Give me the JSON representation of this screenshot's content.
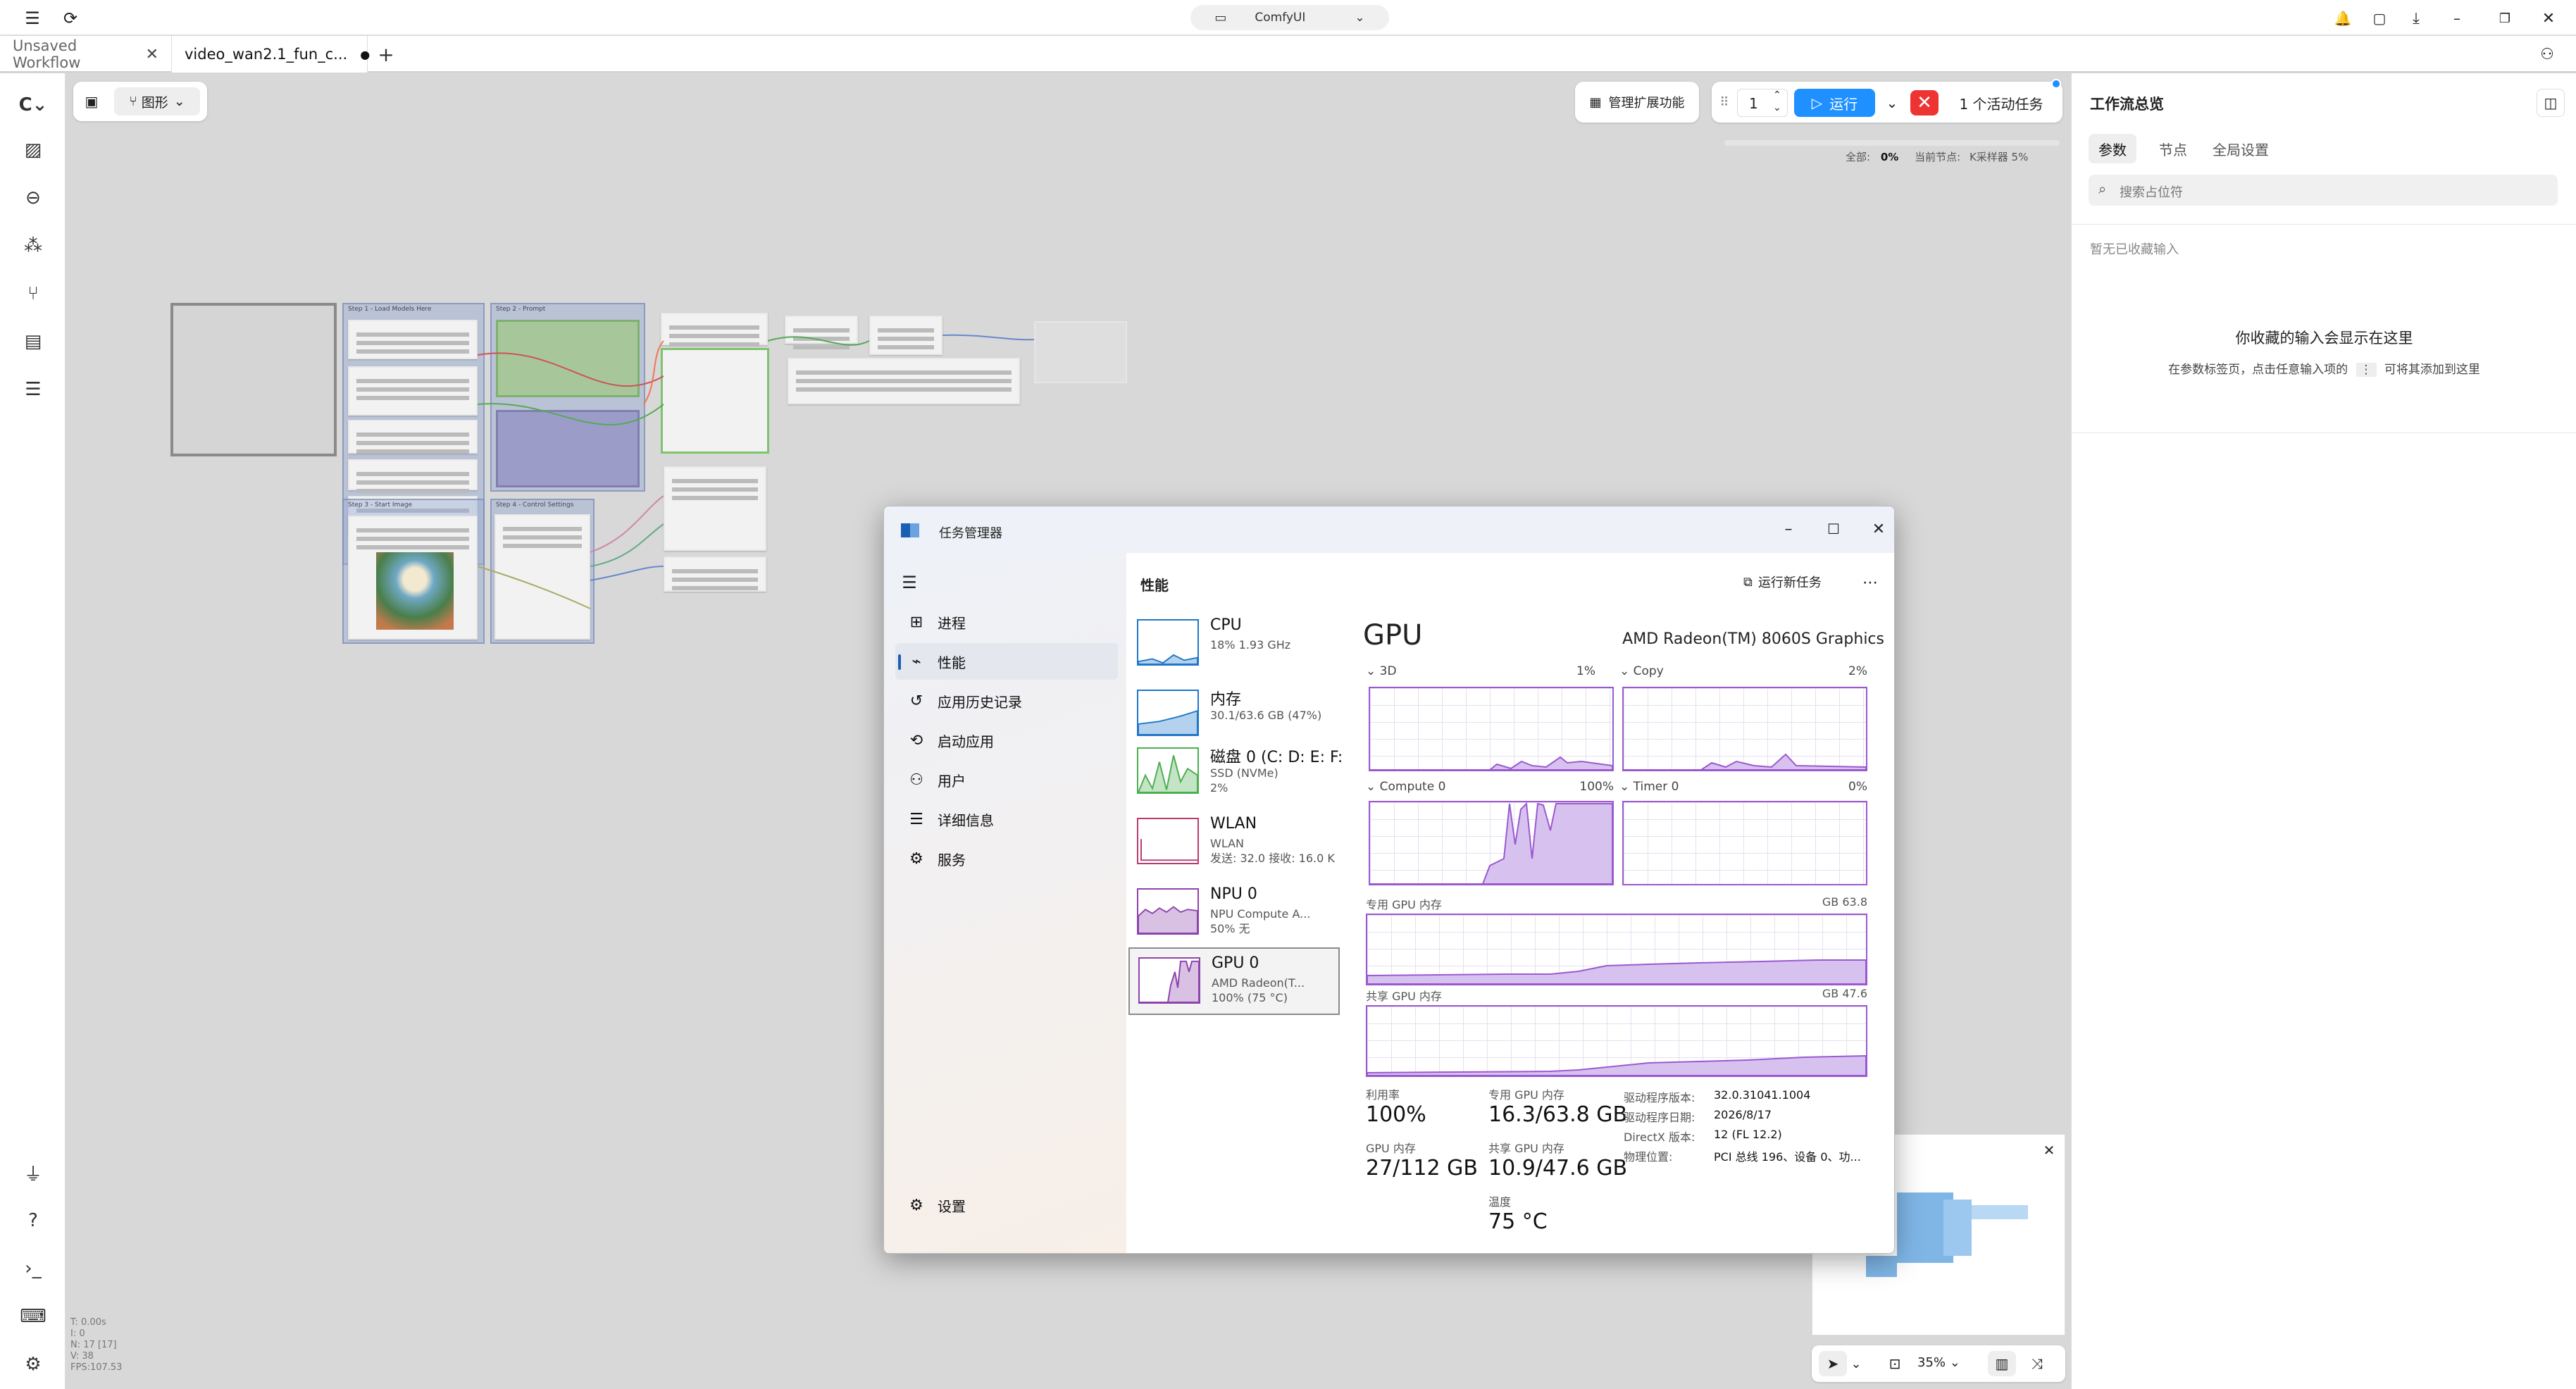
{
  "app": {
    "selector_label": "ComfyUI"
  },
  "tabs": [
    {
      "label": "Unsaved Workflow"
    },
    {
      "label": "video_wan2.1_fun_c..."
    }
  ],
  "toolbar": {
    "view_label": "图形",
    "manage_label": "管理扩展功能",
    "batch_count": "1",
    "run_label": "运行",
    "active_tasks": "1 个活动任务"
  },
  "progress": {
    "total_label": "全部:",
    "total_value": "0%",
    "current_label": "当前节点:",
    "current_node": "K采样器 5%",
    "fraction": 0.0
  },
  "canvas": {
    "groups": [
      "Step 1 - Load Models Here",
      "Step 2 - Prompt",
      "Step 3 - Start Image",
      "Step 4 - Control Settings"
    ]
  },
  "stats": {
    "t": "T: 0.00s",
    "i": "I: 0",
    "n": "N: 17 [17]",
    "v": "V: 38",
    "fps": "FPS:107.53"
  },
  "zoom": {
    "level": "35%"
  },
  "right_panel": {
    "title": "工作流总览",
    "tabs": [
      "参数",
      "节点",
      "全局设置"
    ],
    "search_placeholder": "搜索占位符",
    "empty_label": "暂无已收藏输入",
    "empty_title": "你收藏的输入会显示在这里",
    "empty_hint_pre": "在参数标签页，点击任意输入项的",
    "empty_hint_post": "可将其添加到这里"
  },
  "task_manager": {
    "title": "任务管理器",
    "section_title": "性能",
    "run_new_task": "运行新任务",
    "nav": [
      {
        "label": "进程",
        "icon": "processes-icon"
      },
      {
        "label": "性能",
        "icon": "performance-icon"
      },
      {
        "label": "应用历史记录",
        "icon": "history-icon"
      },
      {
        "label": "启动应用",
        "icon": "startup-icon"
      },
      {
        "label": "用户",
        "icon": "users-icon"
      },
      {
        "label": "详细信息",
        "icon": "details-icon"
      },
      {
        "label": "服务",
        "icon": "services-icon"
      }
    ],
    "settings_label": "设置",
    "resources": [
      {
        "name": "CPU",
        "sub1": "18% 1.93 GHz",
        "sub2": "",
        "color": "#1f77c8"
      },
      {
        "name": "内存",
        "sub1": "30.1/63.6 GB (47%)",
        "sub2": "",
        "color": "#1f77c8"
      },
      {
        "name": "磁盘 0 (C: D: E: F:",
        "sub1": "SSD (NVMe)",
        "sub2": "2%",
        "color": "#4caf50"
      },
      {
        "name": "WLAN",
        "sub1": "WLAN",
        "sub2": "发送: 32.0 接收: 16.0 K",
        "color": "#b83c6e"
      },
      {
        "name": "NPU 0",
        "sub1": "NPU Compute A...",
        "sub2": "50% 无",
        "color": "#8e44ad"
      },
      {
        "name": "GPU 0",
        "sub1": "AMD Radeon(T...",
        "sub2": "100% (75 °C)",
        "color": "#8e44ad"
      }
    ],
    "gpu": {
      "title": "GPU",
      "model": "AMD Radeon(TM) 8060S Graphics",
      "graphs": [
        {
          "label": "3D",
          "pct": "1%"
        },
        {
          "label": "Copy",
          "pct": "2%"
        },
        {
          "label": "Compute 0",
          "pct": "100%"
        },
        {
          "label": "Timer 0",
          "pct": "0%"
        }
      ],
      "dedicated_label": "专用 GPU 内存",
      "dedicated_max": "63.8 GB",
      "shared_label": "共享 GPU 内存",
      "shared_max": "47.6 GB",
      "stats": {
        "util_label": "利用率",
        "util": "100%",
        "gpumem_label": "GPU 内存",
        "gpumem": "27/112 GB",
        "ded_label": "专用 GPU 内存",
        "ded": "16.3/63.8 GB",
        "sh_label": "共享 GPU 内存",
        "sh": "10.9/47.6 GB",
        "temp_label": "温度",
        "temp": "75 °C"
      },
      "details": [
        {
          "k": "驱动程序版本:",
          "v": "32.0.31041.1004"
        },
        {
          "k": "驱动程序日期:",
          "v": "2026/8/17"
        },
        {
          "k": "DirectX 版本:",
          "v": "12 (FL 12.2)"
        },
        {
          "k": "物理位置:",
          "v": "PCI 总线 196、设备 0、功..."
        }
      ]
    }
  }
}
